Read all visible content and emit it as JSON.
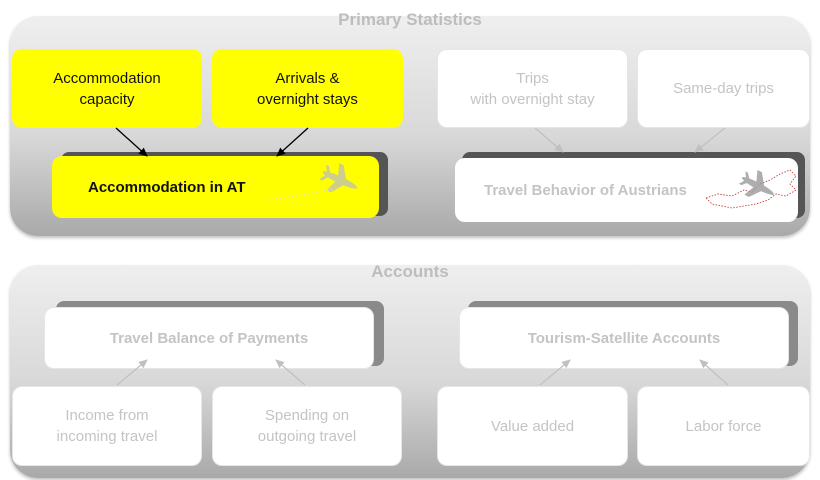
{
  "primary": {
    "title": "Primary Statistics",
    "box_accommodation_capacity": "Accommodation\ncapacity",
    "box_arrivals": "Arrivals &\novernight stays",
    "box_accommodation_at": "Accommodation in AT",
    "box_trips_overnight": "Trips\nwith overnight stay",
    "box_same_day": "Same-day trips",
    "box_travel_behavior": "Travel Behavior of Austrians"
  },
  "accounts": {
    "title": "Accounts",
    "box_travel_balance": "Travel Balance of Payments",
    "box_tsa": "Tourism-Satellite Accounts",
    "box_income": "Income from\nincoming travel",
    "box_spending": "Spending on\noutgoing travel",
    "box_value_added": "Value added",
    "box_labor": "Labor force"
  },
  "icons": [
    "airplane-icon",
    "austria-map-icon"
  ],
  "colors": {
    "highlight": "#ffff00",
    "panel": "#d8d8d8",
    "muted_text": "#c4c4c4"
  }
}
